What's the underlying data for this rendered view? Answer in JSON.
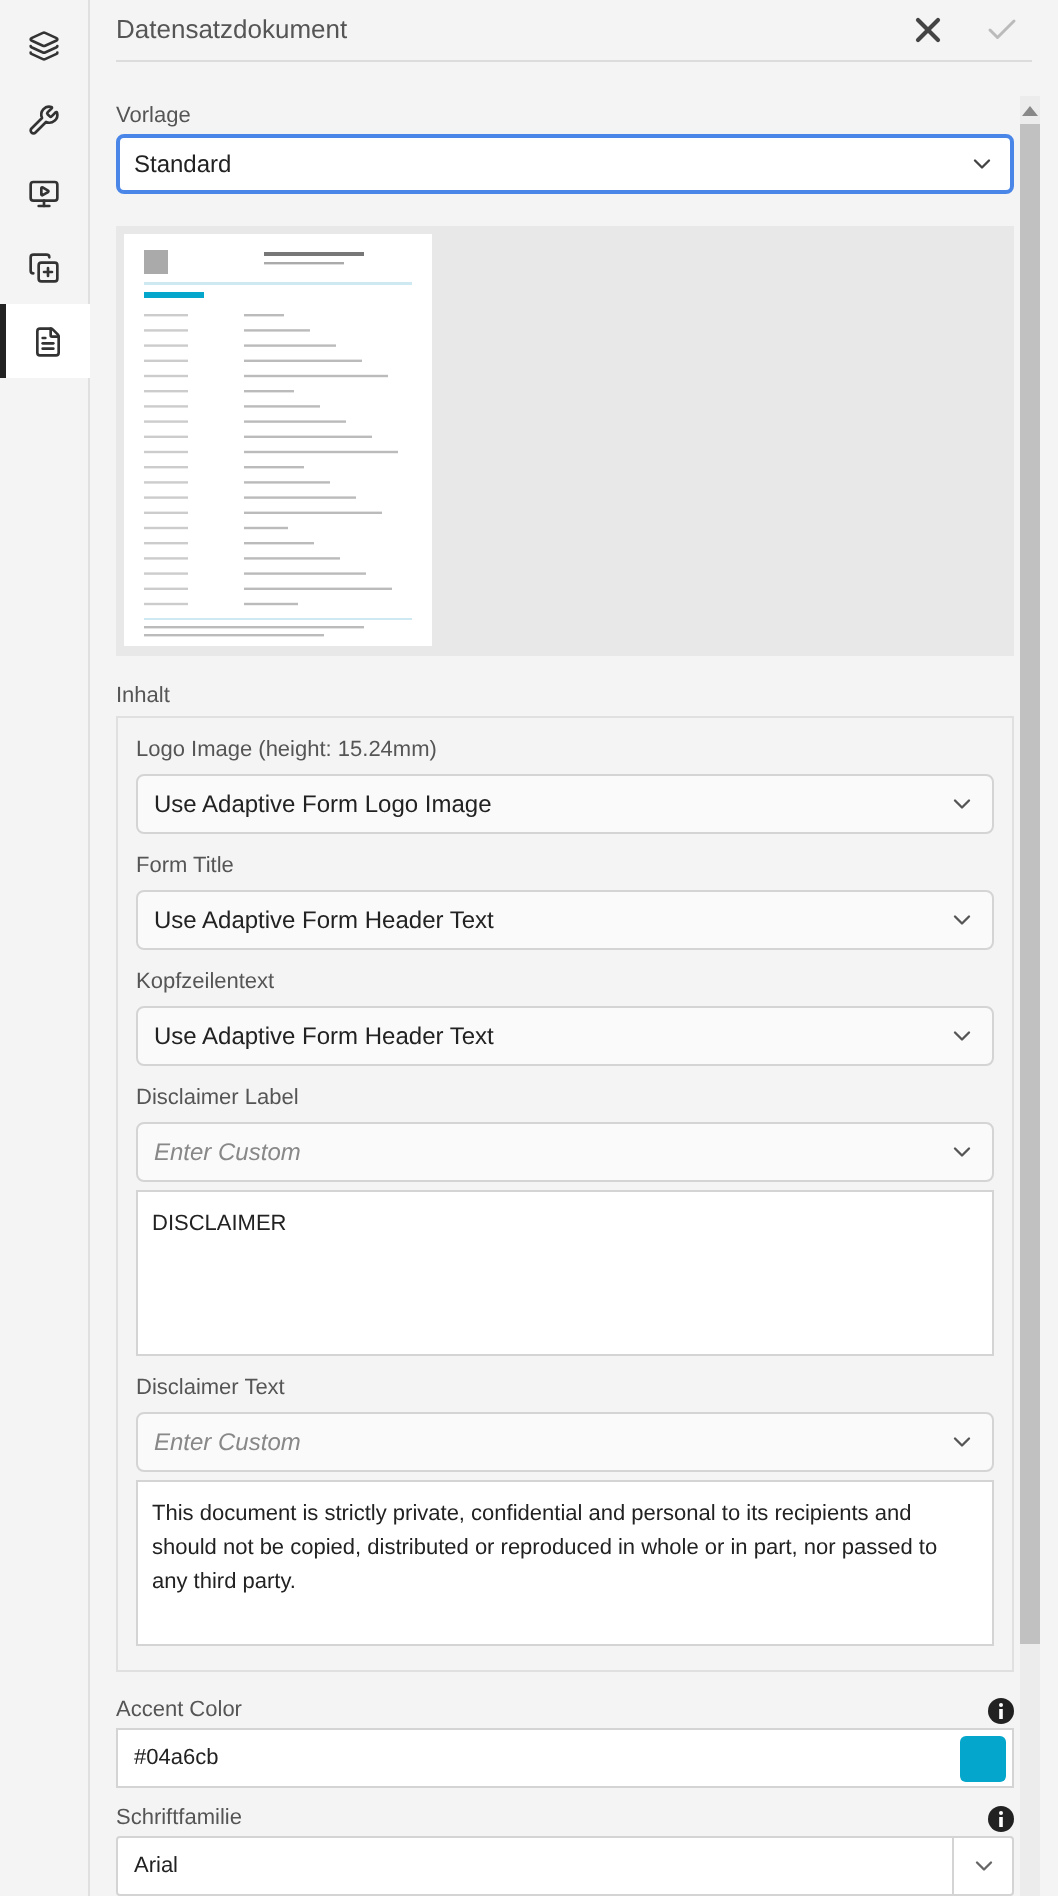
{
  "sidebar": {
    "items": [
      {
        "selected": false
      },
      {
        "selected": false
      },
      {
        "selected": false
      },
      {
        "selected": false
      },
      {
        "selected": true
      }
    ]
  },
  "header": {
    "title": "Datensatzdokument"
  },
  "template": {
    "label": "Vorlage",
    "value": "Standard"
  },
  "content": {
    "label": "Inhalt",
    "fields": [
      {
        "kind": "select",
        "label": "Logo Image (height: 15.24mm)",
        "value": "Use Adaptive Form Logo Image"
      },
      {
        "kind": "select",
        "label": "Form Title",
        "value": "Use Adaptive Form Header Text"
      },
      {
        "kind": "select",
        "label": "Kopfzeilentext",
        "value": "Use Adaptive Form Header Text"
      },
      {
        "kind": "custom",
        "label": "Disclaimer Label",
        "placeholder": "Enter Custom",
        "text": "DISCLAIMER"
      },
      {
        "kind": "custom",
        "label": "Disclaimer Text",
        "placeholder": "Enter Custom",
        "text": "This document is strictly private, confidential and personal to its recipients and should not be copied, distributed or reproduced in whole or in part, nor passed to any third party."
      }
    ]
  },
  "accent_color": {
    "label": "Accent Color",
    "value": "#04a6cb",
    "color": "#04a6cb"
  },
  "font_family": {
    "label": "Schriftfamilie",
    "value": "Arial"
  }
}
